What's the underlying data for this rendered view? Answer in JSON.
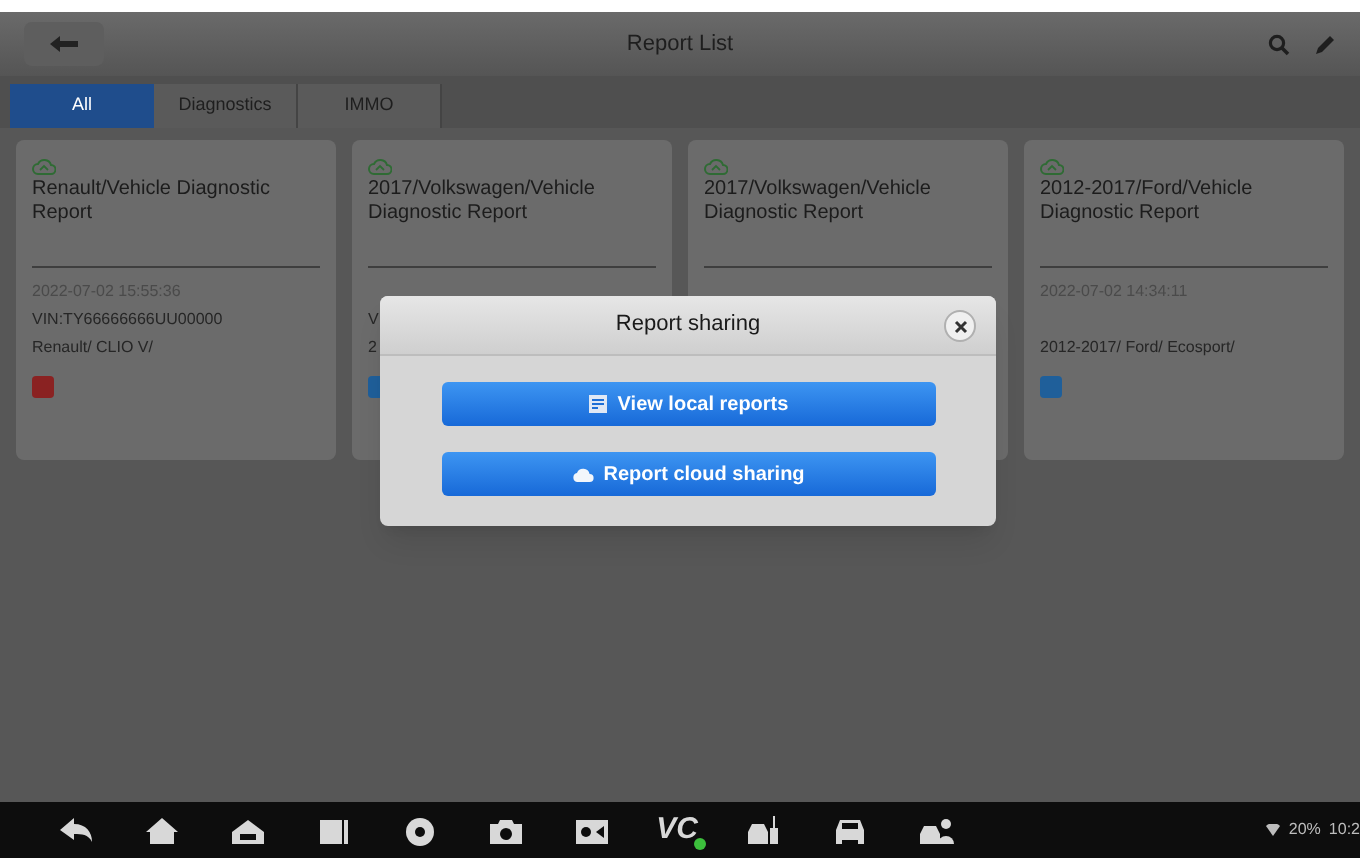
{
  "header": {
    "title": "Report List"
  },
  "tabs": [
    {
      "label": "All",
      "selected": true
    },
    {
      "label": "Diagnostics",
      "selected": false
    },
    {
      "label": "IMMO",
      "selected": false
    }
  ],
  "reports": [
    {
      "title": "Renault/Vehicle Diagnostic Report",
      "date": "2022-07-02 15:55:36",
      "vin": "VIN:TY66666666UU00000",
      "model": "Renault/ CLIO V/",
      "color": "#8a2222"
    },
    {
      "title": "2017/Volkswagen/Vehicle Diagnostic Report",
      "vin": "V",
      "model": "2",
      "color": "#1f5f9a"
    },
    {
      "title": "2017/Volkswagen/Vehicle Diagnostic Report"
    },
    {
      "title": "2012-2017/Ford/Vehicle Diagnostic Report",
      "date": "2022-07-02 14:34:11",
      "model": "2012-2017/ Ford/ Ecosport/",
      "color": "#1f5f9a"
    }
  ],
  "dialog": {
    "title": "Report sharing",
    "buttons": [
      {
        "label": "View local reports",
        "kind": "local"
      },
      {
        "label": "Report cloud sharing",
        "kind": "cloud"
      }
    ]
  },
  "navbar": {
    "vc_label": "VC",
    "battery": "20%",
    "time": "10:2"
  }
}
